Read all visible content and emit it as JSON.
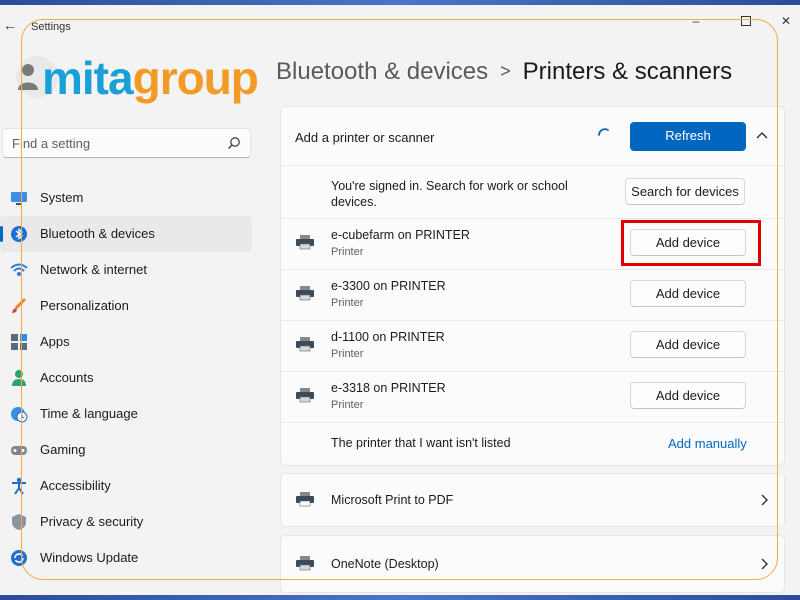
{
  "window": {
    "app_title": "Settings"
  },
  "logo": {
    "text_part1": "mita",
    "text_part2": "group"
  },
  "breadcrumb": {
    "parent": "Bluetooth & devices",
    "separator": ">",
    "current": "Printers & scanners"
  },
  "search": {
    "placeholder": "Find a setting"
  },
  "sidebar": {
    "items": [
      {
        "label": "System",
        "icon": "monitor-icon"
      },
      {
        "label": "Bluetooth & devices",
        "icon": "bluetooth-icon",
        "active": true
      },
      {
        "label": "Network & internet",
        "icon": "wifi-icon"
      },
      {
        "label": "Personalization",
        "icon": "brush-icon"
      },
      {
        "label": "Apps",
        "icon": "apps-icon"
      },
      {
        "label": "Accounts",
        "icon": "person-icon"
      },
      {
        "label": "Time & language",
        "icon": "globe-clock-icon"
      },
      {
        "label": "Gaming",
        "icon": "gamepad-icon"
      },
      {
        "label": "Accessibility",
        "icon": "accessibility-icon"
      },
      {
        "label": "Privacy & security",
        "icon": "shield-icon"
      },
      {
        "label": "Windows Update",
        "icon": "update-icon"
      }
    ]
  },
  "add_section": {
    "title": "Add a printer or scanner",
    "refresh_label": "Refresh",
    "signed_in_text": "You're signed in. Search for work or school devices.",
    "search_devices_label": "Search for devices",
    "printers": [
      {
        "name": "e-cubefarm on PRINTER",
        "type": "Printer",
        "button": "Add device"
      },
      {
        "name": "e-3300 on PRINTER",
        "type": "Printer",
        "button": "Add device"
      },
      {
        "name": "d-1100 on PRINTER",
        "type": "Printer",
        "button": "Add device"
      },
      {
        "name": "e-3318 on PRINTER",
        "type": "Printer",
        "button": "Add device"
      }
    ],
    "not_listed_text": "The printer that I want isn't listed",
    "add_manually_label": "Add manually"
  },
  "installed": [
    {
      "name": "Microsoft Print to PDF"
    },
    {
      "name": "OneNote (Desktop)"
    }
  ],
  "colors": {
    "accent": "#0067c0",
    "highlight": "#e00000",
    "logo_blue": "#1aa0d8",
    "logo_orange": "#f29a25"
  }
}
